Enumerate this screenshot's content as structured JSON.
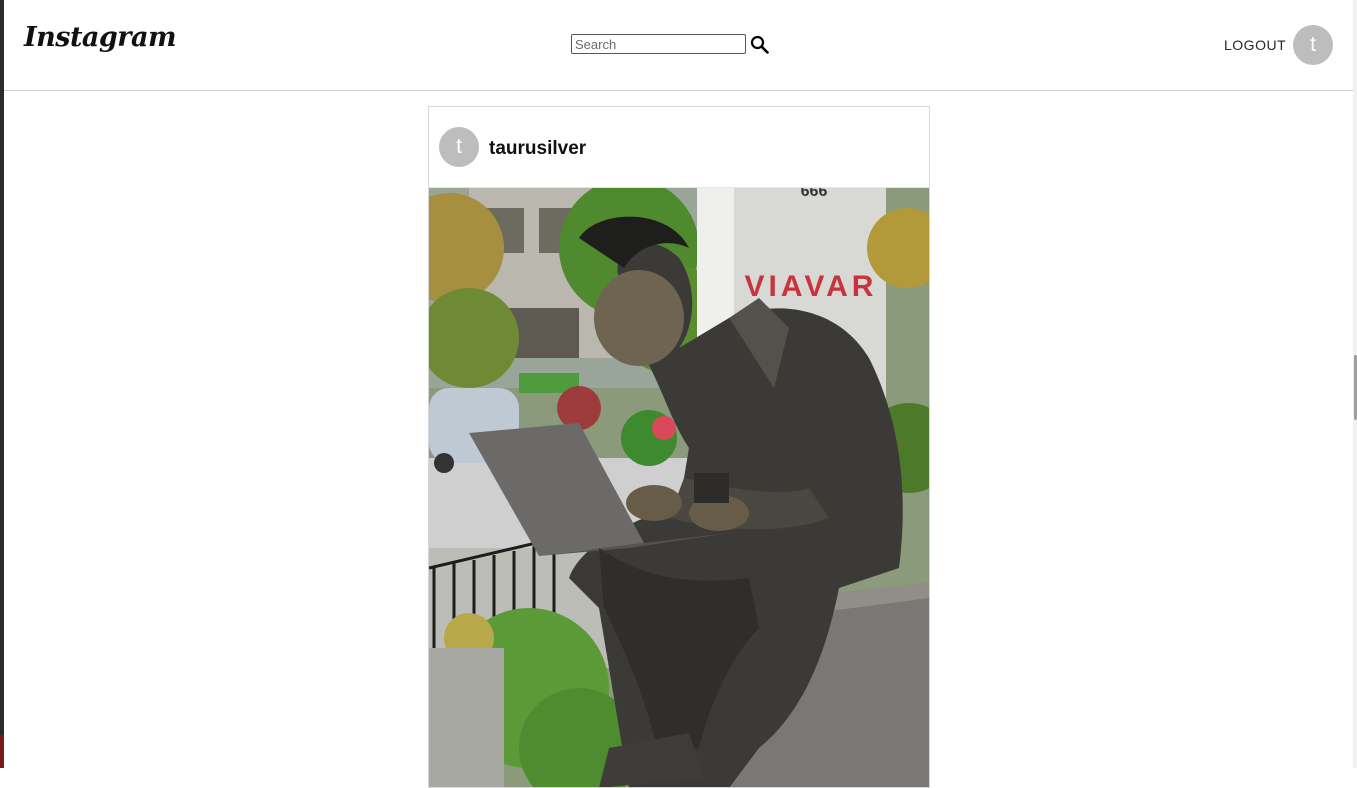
{
  "header": {
    "logo_text": "Instagram",
    "search": {
      "placeholder": "Search",
      "value": ""
    },
    "logout_label": "LOGOUT",
    "avatar_initial": "t"
  },
  "post": {
    "avatar_initial": "t",
    "username": "taurusilver",
    "image": {
      "subject": "bronze statue of a young man typing on a laptop, seated on a bench",
      "sign_text": "VIAVAR",
      "sign_number": "666"
    }
  }
}
